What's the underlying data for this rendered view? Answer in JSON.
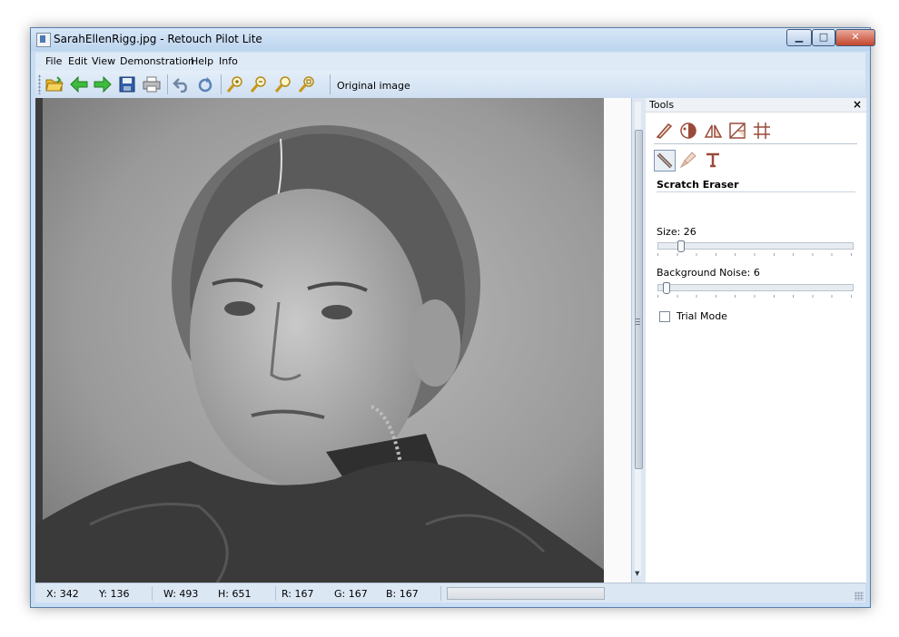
{
  "window": {
    "title": "SarahEllenRigg.jpg - Retouch Pilot Lite",
    "min_symbol": "▁",
    "max_symbol": "□",
    "close_symbol": "✕"
  },
  "menu": [
    "File",
    "Edit",
    "View",
    "Demonstration",
    "Help",
    "Info"
  ],
  "toolbar": {
    "icons": [
      "open-folder",
      "back-arrow",
      "forward-arrow",
      "save-disk",
      "print",
      "undo",
      "redo",
      "zoom-in",
      "zoom-out",
      "zoom-actual",
      "zoom-fit"
    ],
    "original_image_label": "Original image"
  },
  "tools_panel": {
    "title": "Tools",
    "close": "×",
    "row1_icons": [
      "brush-tool",
      "color-tool",
      "geometry-tool",
      "crop-tool",
      "grid-tool"
    ],
    "row2_icons": [
      "scratch-eraser-tool",
      "cosmetic-brush-tool",
      "text-tool"
    ],
    "tool_name": "Scratch Eraser",
    "size_label": "Size: 26",
    "size_value": 26,
    "noise_label": "Background Noise: 6",
    "noise_value": 6,
    "trial_mode_label": "Trial Mode",
    "trial_mode_checked": false
  },
  "status": {
    "x": "X: 342",
    "y": "Y: 136",
    "w": "W: 493",
    "h": "H: 651",
    "r": "R: 167",
    "g": "G: 167",
    "b": "B: 167"
  },
  "colors": {
    "accent": "#4d79b8",
    "tool_icon": "#9a4a3a",
    "photo_tone": "#8e8e8e"
  }
}
